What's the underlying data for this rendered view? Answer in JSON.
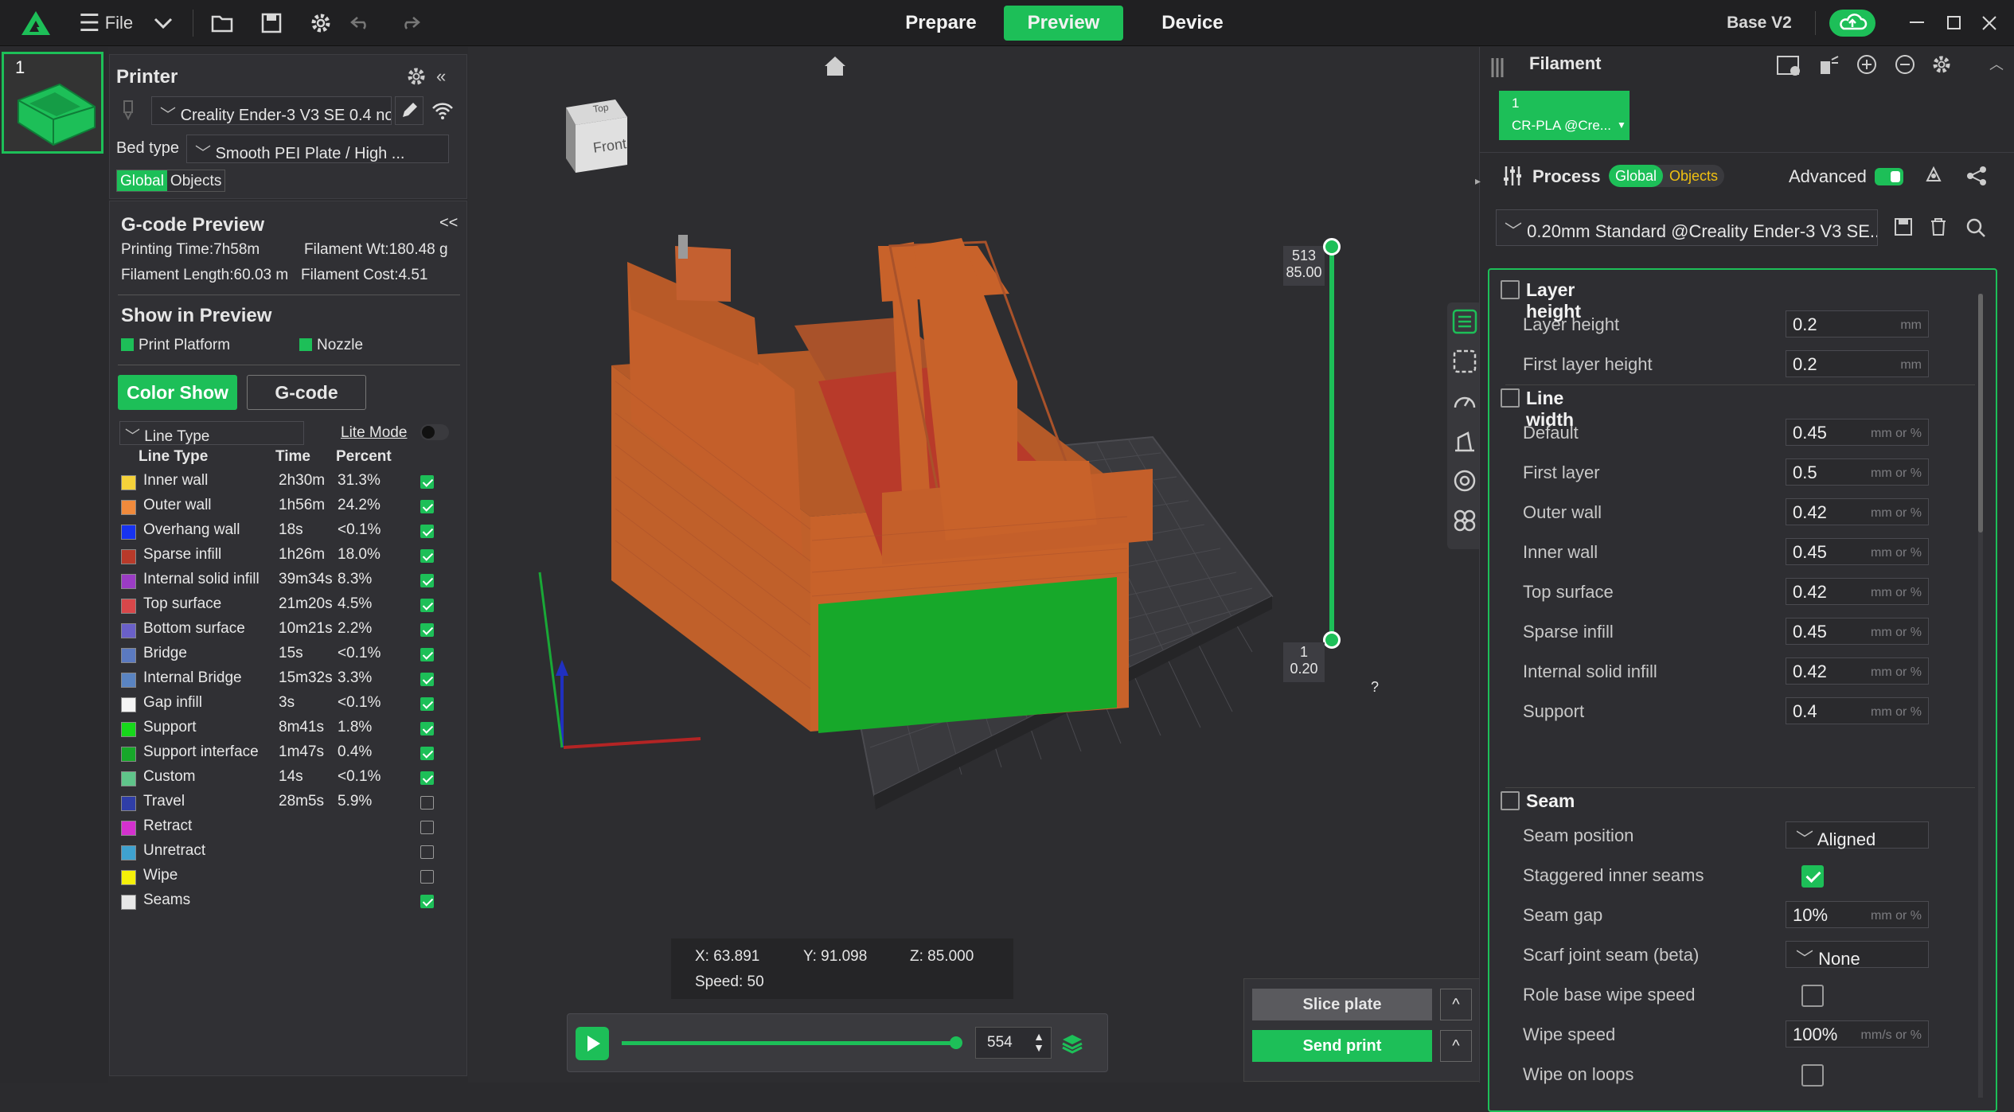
{
  "titlebar": {
    "file_label": "File",
    "tabs": [
      "Prepare",
      "Preview",
      "Device"
    ],
    "active_tab": "Preview",
    "printer_name": "Base V2"
  },
  "plate": {
    "number": "1"
  },
  "printer": {
    "title": "Printer",
    "selected": "Creality Ender-3 V3 SE 0.4 no",
    "bed_type_label": "Bed type",
    "bed_type_value": "Smooth PEI Plate / High ...",
    "scope_tabs": [
      "Global",
      "Objects"
    ]
  },
  "gcode": {
    "title": "G-code Preview",
    "collapse": "<<",
    "printing_time": "Printing Time:7h58m",
    "filament_wt": "Filament Wt:180.48 g",
    "filament_length": "Filament Length:60.03 m",
    "filament_cost": "Filament Cost:4.51",
    "show_title": "Show in Preview",
    "print_platform": "Print Platform",
    "nozzle": "Nozzle",
    "color_show": "Color Show",
    "gcode_btn": "G-code",
    "line_type_select": "Line Type",
    "lite_mode": "Lite Mode",
    "headers": [
      "Line Type",
      "Time",
      "Percent"
    ],
    "rows": [
      {
        "name": "Inner wall",
        "time": "2h30m",
        "percent": "31.3%",
        "color": "#f5d23a",
        "checked": true
      },
      {
        "name": "Outer wall",
        "time": "1h56m",
        "percent": "24.2%",
        "color": "#f08a3c",
        "checked": true
      },
      {
        "name": "Overhang wall",
        "time": "18s",
        "percent": "<0.1%",
        "color": "#1733f0",
        "checked": true
      },
      {
        "name": "Sparse infill",
        "time": "1h26m",
        "percent": "18.0%",
        "color": "#b83a2a",
        "checked": true
      },
      {
        "name": "Internal solid infill",
        "time": "39m34s",
        "percent": "8.3%",
        "color": "#9b3cc4",
        "checked": true
      },
      {
        "name": "Top surface",
        "time": "21m20s",
        "percent": "4.5%",
        "color": "#d8474a",
        "checked": true
      },
      {
        "name": "Bottom surface",
        "time": "10m21s",
        "percent": "2.2%",
        "color": "#6a60c8",
        "checked": true
      },
      {
        "name": "Bridge",
        "time": "15s",
        "percent": "<0.1%",
        "color": "#5b7ac0",
        "checked": true
      },
      {
        "name": "Internal Bridge",
        "time": "15m32s",
        "percent": "3.3%",
        "color": "#5a84c2",
        "checked": true
      },
      {
        "name": "Gap infill",
        "time": "3s",
        "percent": "<0.1%",
        "color": "#f4f4f4",
        "checked": true
      },
      {
        "name": "Support",
        "time": "8m41s",
        "percent": "1.8%",
        "color": "#17d81b",
        "checked": true
      },
      {
        "name": "Support interface",
        "time": "1m47s",
        "percent": "0.4%",
        "color": "#17a82a",
        "checked": true
      },
      {
        "name": "Custom",
        "time": "14s",
        "percent": "<0.1%",
        "color": "#5fc48a",
        "checked": true
      },
      {
        "name": "Travel",
        "time": "28m5s",
        "percent": "5.9%",
        "color": "#2f3ea8",
        "checked": false
      },
      {
        "name": "Retract",
        "time": "",
        "percent": "",
        "color": "#d431cf",
        "checked": false
      },
      {
        "name": "Unretract",
        "time": "",
        "percent": "",
        "color": "#3fa2d0",
        "checked": false
      },
      {
        "name": "Wipe",
        "time": "",
        "percent": "",
        "color": "#f5f00a",
        "checked": false
      },
      {
        "name": "Seams",
        "time": "",
        "percent": "",
        "color": "#e8e8e8",
        "checked": true
      }
    ]
  },
  "viewport": {
    "cube_top": "Top",
    "cube_front": "Front",
    "layer_top_number": "513",
    "layer_top_height": "85.00",
    "layer_bottom_number": "1",
    "layer_bottom_height": "0.20",
    "help": "?",
    "coords": {
      "x": "X: 63.891",
      "y": "Y: 91.098",
      "z": "Z: 85.000",
      "speed": "Speed: 50"
    },
    "move_value": "554",
    "move_progress_fraction": 1.0
  },
  "actions": {
    "slice_plate": "Slice plate",
    "send_print": "Send print",
    "caret": "^"
  },
  "filament": {
    "title": "Filament",
    "slot_number": "1",
    "slot_name": "CR-PLA @Cre..."
  },
  "process": {
    "title": "Process",
    "scope_tabs": [
      "Global",
      "Objects"
    ],
    "advanced_label": "Advanced",
    "preset": "0.20mm Standard @Creality Ender-3 V3 SE...",
    "sections": {
      "layer_height": "Layer height",
      "line_width": "Line width",
      "seam": "Seam"
    },
    "layer_height_rows": [
      {
        "label": "Layer height",
        "value": "0.2",
        "unit": "mm"
      },
      {
        "label": "First layer height",
        "value": "0.2",
        "unit": "mm"
      }
    ],
    "line_width_rows": [
      {
        "label": "Default",
        "value": "0.45",
        "unit": "mm or %"
      },
      {
        "label": "First layer",
        "value": "0.5",
        "unit": "mm or %"
      },
      {
        "label": "Outer wall",
        "value": "0.42",
        "unit": "mm or %"
      },
      {
        "label": "Inner wall",
        "value": "0.45",
        "unit": "mm or %"
      },
      {
        "label": "Top surface",
        "value": "0.42",
        "unit": "mm or %"
      },
      {
        "label": "Sparse infill",
        "value": "0.45",
        "unit": "mm or %"
      },
      {
        "label": "Internal solid infill",
        "value": "0.42",
        "unit": "mm or %"
      },
      {
        "label": "Support",
        "value": "0.4",
        "unit": "mm or %"
      }
    ],
    "seam_rows": {
      "seam_position": {
        "label": "Seam position",
        "value": "Aligned"
      },
      "staggered": {
        "label": "Staggered inner seams",
        "checked": true
      },
      "seam_gap": {
        "label": "Seam gap",
        "value": "10%",
        "unit": "mm or %"
      },
      "scarf": {
        "label": "Scarf joint seam (beta)",
        "value": "None"
      },
      "role_base": {
        "label": "Role base wipe speed",
        "checked": false
      },
      "wipe_speed": {
        "label": "Wipe speed",
        "value": "100%",
        "unit": "mm/s or %"
      },
      "wipe_loops": {
        "label": "Wipe on loops",
        "checked": false
      }
    }
  },
  "colors": {
    "accent": "#1dbf58",
    "object": "#c8622a",
    "support": "#17a82a",
    "top_surface": "#b83a2a"
  }
}
